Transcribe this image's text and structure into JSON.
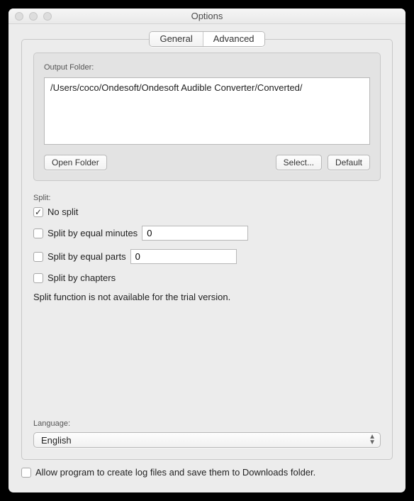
{
  "window": {
    "title": "Options"
  },
  "tabs": {
    "general": "General",
    "advanced": "Advanced",
    "active": "advanced"
  },
  "outputFolder": {
    "label": "Output Folder:",
    "path": "/Users/coco/Ondesoft/Ondesoft Audible Converter/Converted/",
    "openFolder": "Open Folder",
    "select": "Select...",
    "default": "Default"
  },
  "split": {
    "label": "Split:",
    "noSplit": {
      "label": "No split",
      "checked": true
    },
    "byMinutes": {
      "label": "Split by equal minutes",
      "checked": false,
      "value": "0"
    },
    "byParts": {
      "label": "Split by equal parts",
      "checked": false,
      "value": "0"
    },
    "byChapters": {
      "label": "Split by chapters",
      "checked": false
    },
    "warning": "Split function is not available for the trial version."
  },
  "language": {
    "label": "Language:",
    "value": "English"
  },
  "allowLog": {
    "label": "Allow program to create log files and save them to Downloads folder.",
    "checked": false
  }
}
